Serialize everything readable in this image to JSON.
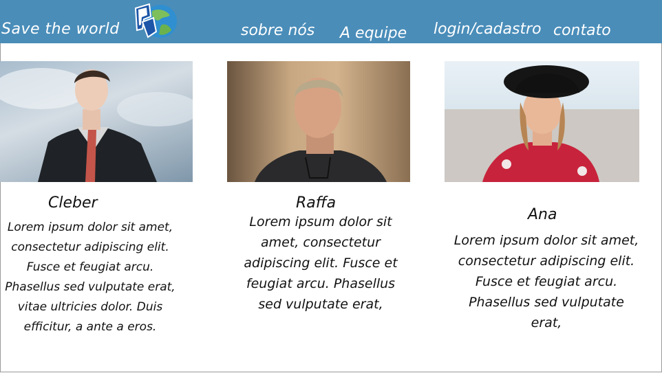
{
  "header": {
    "brand": "Save the world",
    "nav": {
      "sobre": "sobre nós",
      "equipe": "A equipe",
      "login": "login/cadastro",
      "contato": "contato"
    }
  },
  "team": [
    {
      "name": "Cleber",
      "bio": "Lorem ipsum dolor sit amet, consectetur adipiscing elit. Fusce et feugiat arcu. Phasellus sed vulputate erat, vitae ultricies dolor. Duis efficitur, a ante a eros."
    },
    {
      "name": "Raffa",
      "bio": "Lorem ipsum dolor sit amet, consectetur adipiscing elit. Fusce et feugiat arcu. Phasellus sed vulputate erat,"
    },
    {
      "name": "Ana",
      "bio": "Lorem ipsum dolor sit amet, consectetur adipiscing elit. Fusce et feugiat arcu. Phasellus sed vulputate erat,"
    }
  ],
  "colors": {
    "header_bg": "#4a8db9",
    "text": "#111111"
  }
}
